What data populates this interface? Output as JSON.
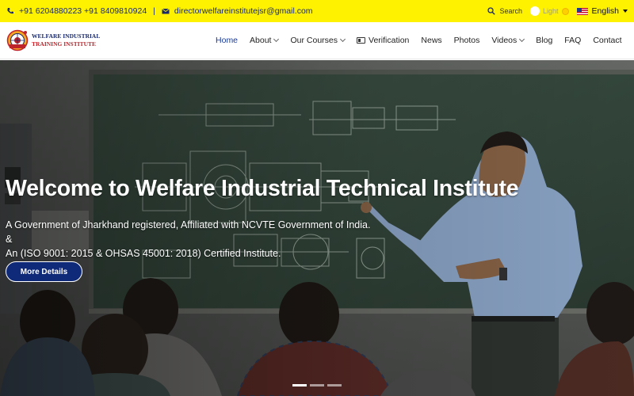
{
  "topbar": {
    "phones": "+91 6204880223 +91 8409810924",
    "separator": "|",
    "email": "directorwelfareinstitutejsr@gmail.com",
    "search_label": "Search",
    "theme_label": "Light",
    "language": "English",
    "bg_color": "#fff200"
  },
  "logo": {
    "line1": "WELFARE INDUSTRIAL",
    "line2": "TRAINING INSTITUTE"
  },
  "nav": {
    "items": [
      {
        "label": "Home",
        "active": true
      },
      {
        "label": "About",
        "dropdown": true
      },
      {
        "label": "Our Courses",
        "dropdown": true
      },
      {
        "label": "Verification",
        "icon": "id-card-icon"
      },
      {
        "label": "News"
      },
      {
        "label": "Photos"
      },
      {
        "label": "Videos",
        "dropdown": true
      },
      {
        "label": "Blog"
      },
      {
        "label": "FAQ"
      },
      {
        "label": "Contact"
      }
    ]
  },
  "hero": {
    "title": "Welcome to Welfare Industrial Technical Institute",
    "subtitle_line1": "A Government of Jharkhand registered, Affiliated with NCVTE Government of India. &",
    "subtitle_line2": "An (ISO 9001: 2015 & OHSAS 45001: 2018) Certified Institute.",
    "button_label": "More Details",
    "button_color": "#102a7a",
    "slides": 3,
    "active_slide": 1
  }
}
